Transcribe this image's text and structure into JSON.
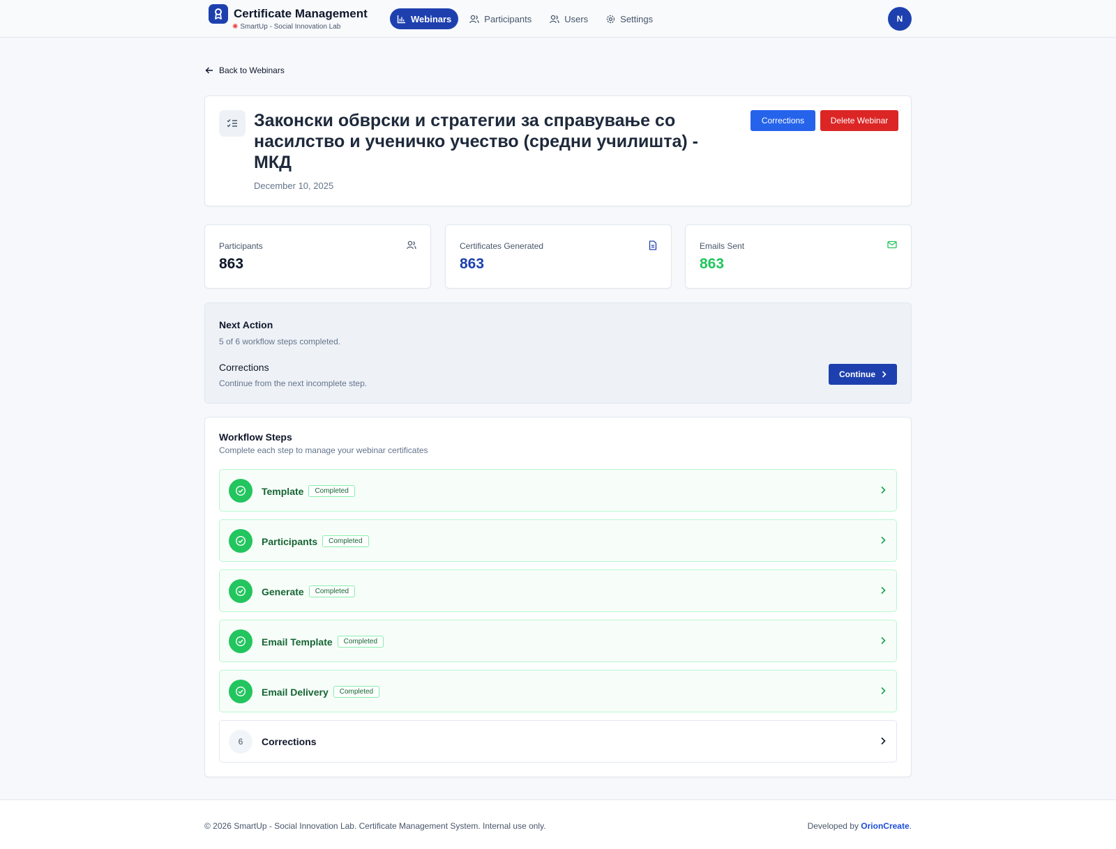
{
  "brand": {
    "title": "Certificate Management",
    "subtitle": "SmartUp - Social Innovation Lab"
  },
  "nav": {
    "items": [
      {
        "label": "Webinars",
        "icon": "bar-chart-icon",
        "active": true
      },
      {
        "label": "Participants",
        "icon": "users-icon",
        "active": false
      },
      {
        "label": "Users",
        "icon": "users-icon",
        "active": false
      },
      {
        "label": "Settings",
        "icon": "gear-icon",
        "active": false
      }
    ]
  },
  "user": {
    "initial": "N"
  },
  "back_link": "Back to Webinars",
  "webinar": {
    "title": "Законски обврски и стратегии за справување со насилство и ученичко учество (средни училишта) - МКД",
    "date": "December 10, 2025",
    "buttons": {
      "corrections": "Corrections",
      "delete": "Delete Webinar"
    }
  },
  "stats": [
    {
      "label": "Participants",
      "value": "863",
      "icon": "users-icon",
      "color": "#0f172a"
    },
    {
      "label": "Certificates Generated",
      "value": "863",
      "icon": "document-icon",
      "color": "#1e40af"
    },
    {
      "label": "Emails Sent",
      "value": "863",
      "icon": "mail-icon",
      "color": "#22c55e"
    }
  ],
  "next_action": {
    "title": "Next Action",
    "progress": "5 of 6 workflow steps completed.",
    "step": "Corrections",
    "step_sub": "Continue from the next incomplete step.",
    "button": "Continue"
  },
  "workflow": {
    "title": "Workflow Steps",
    "subtitle": "Complete each step to manage your webinar certificates",
    "steps": [
      {
        "name": "Template",
        "badge": "Completed",
        "status": "completed"
      },
      {
        "name": "Participants",
        "badge": "Completed",
        "status": "completed"
      },
      {
        "name": "Generate",
        "badge": "Completed",
        "status": "completed"
      },
      {
        "name": "Email Template",
        "badge": "Completed",
        "status": "completed"
      },
      {
        "name": "Email Delivery",
        "badge": "Completed",
        "status": "completed"
      },
      {
        "name": "Corrections",
        "number": "6",
        "status": "pending"
      }
    ]
  },
  "footer": {
    "left": "© 2026 SmartUp - Social Innovation Lab. Certificate Management System. Internal use only.",
    "right_prefix": "Developed by",
    "right_link": "OrionCreate",
    "right_suffix": "."
  },
  "colors": {
    "primary": "#1e40af",
    "accent_blue": "#2563eb",
    "danger": "#dc2626",
    "success": "#22c55e"
  }
}
